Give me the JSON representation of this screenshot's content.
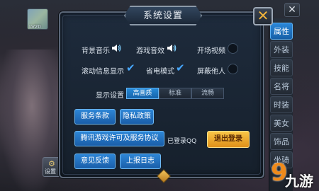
{
  "window": {
    "title": "系统设置",
    "close_glyph": "✕",
    "corner_close_glyph": "✕"
  },
  "player": {
    "level_badge": "LV20"
  },
  "left_settings_button": {
    "label": "设置"
  },
  "side_tabs": [
    {
      "label": "属性",
      "active": true
    },
    {
      "label": "外装",
      "active": false
    },
    {
      "label": "技能",
      "active": false
    },
    {
      "label": "名将",
      "active": false
    },
    {
      "label": "时装",
      "active": false
    },
    {
      "label": "美女",
      "active": false
    },
    {
      "label": "饰品",
      "active": false
    },
    {
      "label": "坐骑",
      "active": false
    }
  ],
  "settings": {
    "bg_music": {
      "label": "背景音乐",
      "state": "on",
      "icon": "speaker-on-icon"
    },
    "game_sfx": {
      "label": "游戏音效",
      "state": "on",
      "icon": "speaker-on-icon"
    },
    "intro_video": {
      "label": "开场视频",
      "state": "off"
    },
    "scroll_info": {
      "label": "滚动信息显示",
      "checked": true
    },
    "power_save": {
      "label": "省电模式",
      "checked": true
    },
    "hide_others": {
      "label": "屏蔽他人",
      "checked": false
    }
  },
  "display": {
    "label": "显示设置",
    "options": [
      "高画质",
      "标准",
      "流畅"
    ],
    "selected": "高画质"
  },
  "buttons": {
    "terms": "服务条款",
    "privacy": "隐私政策",
    "license": "腾讯游戏许可及服务协议",
    "feedback": "意见反馈",
    "report_log": "上报日志",
    "logout": "退出登录"
  },
  "login_status": "已登录QQ",
  "watermark": {
    "digit": "9",
    "text": "九游"
  },
  "colors": {
    "accent_blue": "#2a86d8",
    "check_blue": "#46a7ff",
    "gold": "#f2b53a",
    "panel_bg": "#1b2634"
  }
}
